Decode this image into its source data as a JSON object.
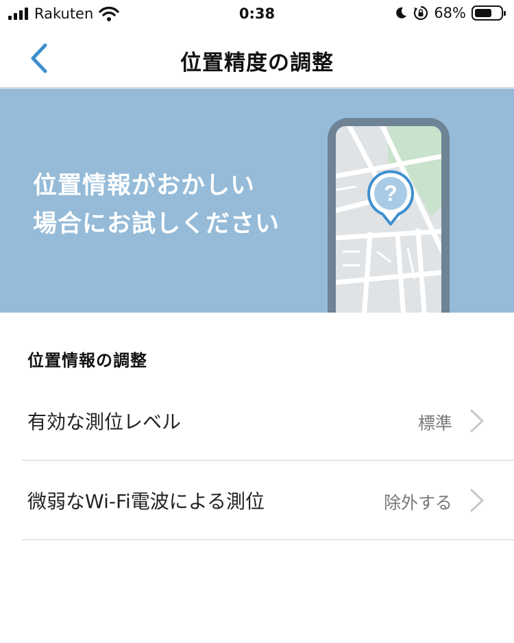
{
  "status_bar": {
    "carrier": "Rakuten",
    "time": "0:38",
    "battery_percent": "68%",
    "battery_level": 0.68,
    "icons": [
      "signal-bars-icon",
      "wifi-icon",
      "moon-icon",
      "orientation-lock-icon",
      "battery-icon"
    ]
  },
  "nav": {
    "title": "位置精度の調整",
    "back_icon": "chevron-left-icon"
  },
  "banner": {
    "line1": "位置情報がおかしい",
    "line2": "場合にお試しください",
    "pin_symbol": "?"
  },
  "section": {
    "header": "位置情報の調整"
  },
  "settings": [
    {
      "label": "有効な測位レベル",
      "value": "標準"
    },
    {
      "label": "微弱なWi-Fi電波による測位",
      "value": "除外する"
    }
  ],
  "colors": {
    "accent": "#3d8fce",
    "banner_bg": "#95bbd8",
    "phone_frame": "#6e8394",
    "map_green": "#c9e2cb",
    "pin_fill": "#a9cbe6"
  }
}
